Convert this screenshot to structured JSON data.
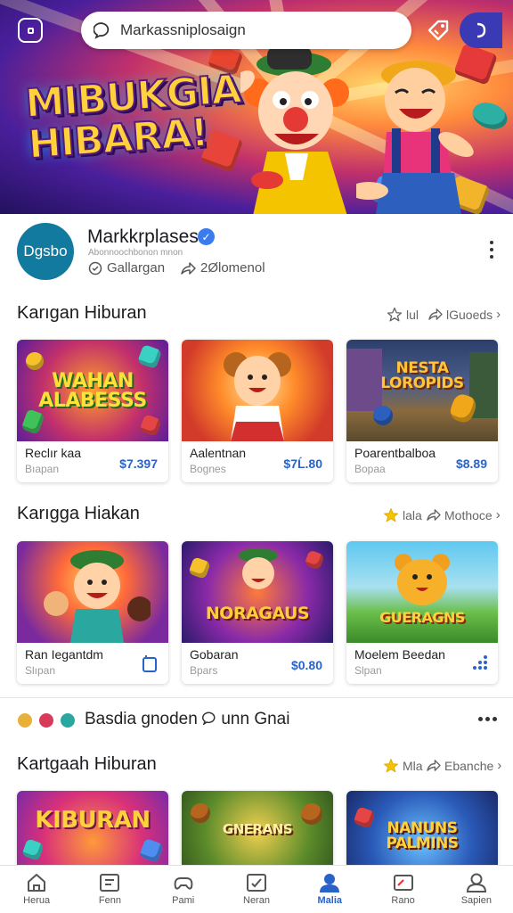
{
  "header": {
    "search_placeholder": "Markassniplosaign",
    "hero_title": "MIBUKGIA HIBARA!"
  },
  "channel": {
    "avatar_text": "Dgsbo",
    "name": "Markkrplases",
    "subline": "Abonnoochbonon mnon",
    "stat1": "Gallargan",
    "stat2": "2Ølomenol"
  },
  "sections": [
    {
      "title": "Karıgan Hiburan",
      "action1": "lul",
      "action2": "lGuoeds",
      "cards": [
        {
          "thumb_text": "WAHAN ALABESSS",
          "title": "Reclır kaa",
          "sub": "Bıapan",
          "price": "$7.397"
        },
        {
          "thumb_text": "",
          "title": "Aalentnan",
          "sub": "Bognes",
          "price": "$7Ĺ.80"
        },
        {
          "thumb_text": "NESTA LOROPIDS",
          "title": "Poarentbalboa",
          "sub": "Bopaa",
          "price": "$8.89"
        }
      ]
    },
    {
      "title": "Karıgga Hiakan",
      "action1": "lala",
      "action2": "Mothoce",
      "cards": [
        {
          "thumb_text": "",
          "title": "Ran Iegantdm",
          "sub": "Slıpan",
          "price": ""
        },
        {
          "thumb_text": "NORAGAUS",
          "title": "Gobaran",
          "sub": "Bpars",
          "price": "$0.80"
        },
        {
          "thumb_text": "GUERAGNS",
          "title": "Moelem Beedan",
          "sub": "Slpan",
          "price": ""
        }
      ]
    },
    {
      "title": "Kartgaah Hiburan",
      "action1": "Mla",
      "action2": "Ebanche",
      "cards": [
        {
          "thumb_text": "KIBURAN"
        },
        {
          "thumb_text": "GNERANS"
        },
        {
          "thumb_text": "NANUNS PALMINS"
        }
      ]
    }
  ],
  "social": {
    "text": "Basdia gnoden",
    "text2": "unn Gnai"
  },
  "nav": [
    {
      "label": "Herua",
      "icon": "home-icon"
    },
    {
      "label": "Fenn",
      "icon": "feed-icon"
    },
    {
      "label": "Pami",
      "icon": "gamepad-icon"
    },
    {
      "label": "Neran",
      "icon": "check-box-icon"
    },
    {
      "label": "Malia",
      "icon": "user-active-icon",
      "active": true
    },
    {
      "label": "Rano",
      "icon": "card-icon"
    },
    {
      "label": "Sapien",
      "icon": "profile-icon"
    }
  ],
  "colors": {
    "accent": "#2a63c8",
    "avatar_bg": "#117a9e",
    "hero_purple": "#4a1f9c"
  }
}
